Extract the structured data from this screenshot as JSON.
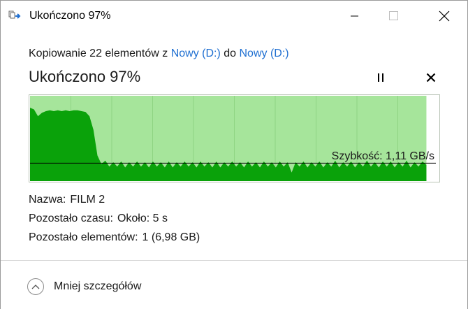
{
  "window": {
    "title": "Ukończono 97%"
  },
  "copy": {
    "prefix": "Kopiowanie 22 elementów z",
    "source": "Nowy (D:)",
    "middle": "do",
    "destination": "Nowy (D:)"
  },
  "progress": {
    "title": "Ukończono 97%",
    "percent": 97
  },
  "chart_data": {
    "type": "area",
    "series": [
      {
        "values": [
          0.86,
          0.84,
          0.76,
          0.8,
          0.82,
          0.83,
          0.82,
          0.83,
          0.82,
          0.83,
          0.82,
          0.83,
          0.83,
          0.82,
          0.81,
          0.76,
          0.6,
          0.3,
          0.2,
          0.24,
          0.17,
          0.22,
          0.17,
          0.23,
          0.16,
          0.22,
          0.17,
          0.23,
          0.17,
          0.22,
          0.16,
          0.23,
          0.17,
          0.22,
          0.16,
          0.23,
          0.16,
          0.22,
          0.17,
          0.23,
          0.17,
          0.22,
          0.16,
          0.23,
          0.17,
          0.22,
          0.16,
          0.23,
          0.16,
          0.22,
          0.17,
          0.23,
          0.17,
          0.22,
          0.16,
          0.23,
          0.17,
          0.22,
          0.16,
          0.23,
          0.17,
          0.22,
          0.16,
          0.23,
          0.17,
          0.22,
          0.1,
          0.22,
          0.17,
          0.23,
          0.16,
          0.22,
          0.17,
          0.23,
          0.16,
          0.22,
          0.17,
          0.24,
          0.16,
          0.22,
          0.17,
          0.23,
          0.16,
          0.22,
          0.17,
          0.24,
          0.17,
          0.22,
          0.16,
          0.23,
          0.17,
          0.23,
          0.16,
          0.22,
          0.17,
          0.24,
          0.16,
          0.22,
          0.17,
          0.23,
          0.19
        ]
      }
    ],
    "current_speed_fraction": 0.21,
    "completed_fraction": 0.97,
    "speed_label": "Szybkość: 1,11 GB/s",
    "colors": {
      "completed_bg": "#a6e59b",
      "graph": "#0aa20a",
      "grid": "#8fd483",
      "border": "#b9c4b6",
      "line": "#000000"
    }
  },
  "details": {
    "name_label": "Nazwa:",
    "name_value": "FILM 2",
    "time_label": "Pozostało czasu:",
    "time_value": "Około: 5 s",
    "items_label": "Pozostało elementów:",
    "items_value": "1 (6,98 GB)"
  },
  "footer": {
    "less_details": "Mniej szczegółów"
  }
}
